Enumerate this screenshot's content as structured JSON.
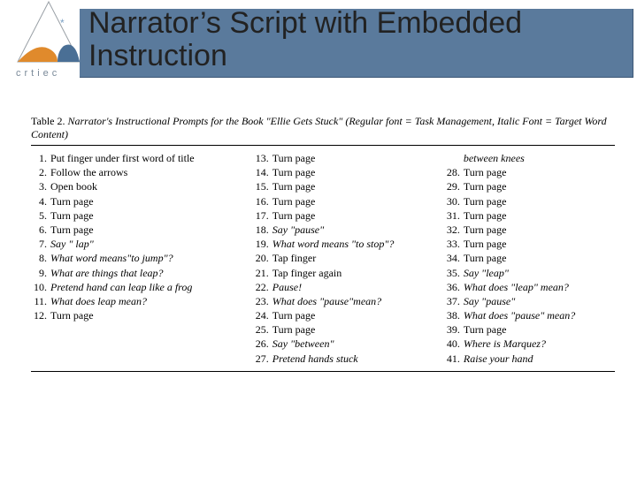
{
  "title": "Narrator’s Script with Embedded Instruction",
  "logo": {
    "text": "crtiec"
  },
  "table": {
    "label": "Table 2.  ",
    "subtitle": "Narrator's Instructional Prompts for the Book \"Ellie Gets Stuck\" (Regular font = Task Management, Italic Font = Target Word Content)"
  },
  "col3_orphan": {
    "text": "between knees",
    "italic": true
  },
  "prompts": [
    {
      "n": 1,
      "text": "Put finger under first word of title",
      "italic": false
    },
    {
      "n": 2,
      "text": "Follow the arrows",
      "italic": false
    },
    {
      "n": 3,
      "text": "Open book",
      "italic": false
    },
    {
      "n": 4,
      "text": "Turn page",
      "italic": false
    },
    {
      "n": 5,
      "text": "Turn page",
      "italic": false
    },
    {
      "n": 6,
      "text": "Turn page",
      "italic": false
    },
    {
      "n": 7,
      "text": "Say \"  lap\"",
      "italic": true
    },
    {
      "n": 8,
      "text": "What word means\"to jump\"?",
      "italic": true
    },
    {
      "n": 9,
      "text": "What are things that leap?",
      "italic": true
    },
    {
      "n": 10,
      "text": "Pretend hand can leap like a frog",
      "italic": true
    },
    {
      "n": 11,
      "text": "What does leap mean?",
      "italic": true
    },
    {
      "n": 12,
      "text": "Turn page",
      "italic": false
    },
    {
      "n": 13,
      "text": "Turn page",
      "italic": false
    },
    {
      "n": 14,
      "text": "Turn page",
      "italic": false
    },
    {
      "n": 15,
      "text": "Turn page",
      "italic": false
    },
    {
      "n": 16,
      "text": "Turn page",
      "italic": false
    },
    {
      "n": 17,
      "text": "Turn page",
      "italic": false
    },
    {
      "n": 18,
      "text": "Say \"pause\"",
      "italic": true
    },
    {
      "n": 19,
      "text": "What word means \"to stop\"?",
      "italic": true
    },
    {
      "n": 20,
      "text": "Tap finger",
      "italic": false
    },
    {
      "n": 21,
      "text": "Tap finger again",
      "italic": false
    },
    {
      "n": 22,
      "text": "Pause!",
      "italic": true
    },
    {
      "n": 23,
      "text": "What does \"pause\"mean?",
      "italic": true
    },
    {
      "n": 24,
      "text": "Turn page",
      "italic": false
    },
    {
      "n": 25,
      "text": "Turn page",
      "italic": false
    },
    {
      "n": 26,
      "text": "Say \"between\"",
      "italic": true
    },
    {
      "n": 27,
      "text": "Pretend hands stuck",
      "italic": true
    },
    {
      "n": 28,
      "text": "Turn page",
      "italic": false
    },
    {
      "n": 29,
      "text": "Turn page",
      "italic": false
    },
    {
      "n": 30,
      "text": "Turn page",
      "italic": false
    },
    {
      "n": 31,
      "text": "Turn page",
      "italic": false
    },
    {
      "n": 32,
      "text": "Turn page",
      "italic": false
    },
    {
      "n": 33,
      "text": "Turn page",
      "italic": false
    },
    {
      "n": 34,
      "text": "Turn page",
      "italic": false
    },
    {
      "n": 35,
      "text": "Say \"leap\"",
      "italic": true
    },
    {
      "n": 36,
      "text": "What does \"leap\" mean?",
      "italic": true
    },
    {
      "n": 37,
      "text": "Say \"pause\"",
      "italic": true
    },
    {
      "n": 38,
      "text": "What does \"pause\" mean?",
      "italic": true
    },
    {
      "n": 39,
      "text": "Turn page",
      "italic": false
    },
    {
      "n": 40,
      "text": "Where is Marquez?",
      "italic": true
    },
    {
      "n": 41,
      "text": "Raise your hand",
      "italic": true
    }
  ],
  "layout": {
    "col1_end": 12,
    "col2_end": 27
  }
}
